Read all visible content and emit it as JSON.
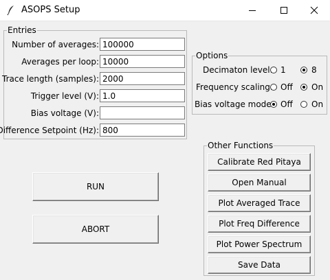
{
  "window": {
    "title": "ASOPS Setup"
  },
  "entries": {
    "legend": "Entries",
    "rows": [
      {
        "label": "Number of averages:",
        "value": "100000"
      },
      {
        "label": "Averages per loop:",
        "value": "10000"
      },
      {
        "label": "Trace length (samples):",
        "value": "2000"
      },
      {
        "label": "Trigger level (V):",
        "value": "1.0"
      },
      {
        "label": "Bias voltage (V):",
        "value": ""
      },
      {
        "label": "Difference Setpoint (Hz):",
        "value": "800"
      }
    ]
  },
  "options": {
    "legend": "Options",
    "rows": [
      {
        "label": "Decimaton level:",
        "choices": [
          "1",
          "8"
        ],
        "selected": "8"
      },
      {
        "label": "Frequency scaling:",
        "choices": [
          "Off",
          "On"
        ],
        "selected": "On"
      },
      {
        "label": "Bias voltage mode:",
        "choices": [
          "Off",
          "On"
        ],
        "selected": "Off"
      }
    ]
  },
  "actions": {
    "run": "RUN",
    "abort": "ABORT"
  },
  "other": {
    "legend": "Other Functions",
    "buttons": [
      "Calibrate Red Pitaya",
      "Open Manual",
      "Plot Averaged Trace",
      "Plot Freq Difference",
      "Plot Power Spectrum",
      "Save Data"
    ]
  },
  "icons": {
    "app": "feather-icon",
    "minimize": "minimize-icon",
    "maximize": "maximize-icon",
    "close": "close-icon"
  }
}
